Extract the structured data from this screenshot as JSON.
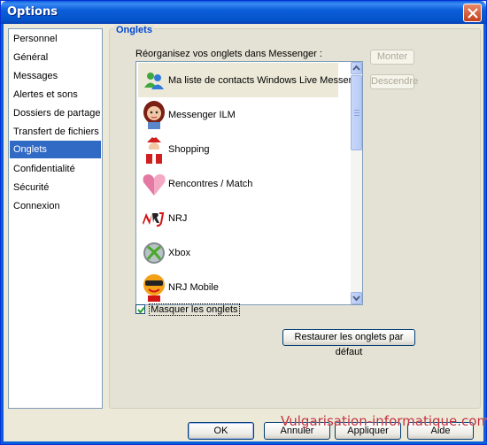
{
  "window": {
    "title": "Options"
  },
  "categories": [
    {
      "label": "Personnel",
      "selected": false
    },
    {
      "label": "Général",
      "selected": false
    },
    {
      "label": "Messages",
      "selected": false
    },
    {
      "label": "Alertes et sons",
      "selected": false
    },
    {
      "label": "Dossiers de partage",
      "selected": false
    },
    {
      "label": "Transfert de fichiers",
      "selected": false
    },
    {
      "label": "Onglets",
      "selected": true
    },
    {
      "label": "Confidentialité",
      "selected": false
    },
    {
      "label": "Sécurité",
      "selected": false
    },
    {
      "label": "Connexion",
      "selected": false
    }
  ],
  "panel": {
    "title": "Onglets",
    "instruction": "Réorganisez vos onglets dans Messenger :",
    "tabs": [
      {
        "label": "Ma liste de contacts Windows Live Messenger",
        "icon": "contacts-icon",
        "selected": true
      },
      {
        "label": "Messenger ILM",
        "icon": "girl-avatar-icon",
        "selected": false
      },
      {
        "label": "Shopping",
        "icon": "santa-shopping-icon",
        "selected": false
      },
      {
        "label": "Rencontres / Match",
        "icon": "heart-icon",
        "selected": false
      },
      {
        "label": "NRJ",
        "icon": "nrj-logo-icon",
        "selected": false
      },
      {
        "label": "Xbox",
        "icon": "xbox-icon",
        "selected": false
      },
      {
        "label": "NRJ Mobile",
        "icon": "nrj-mobile-icon",
        "selected": false
      }
    ],
    "move_up": "Monter",
    "move_down": "Descendre",
    "hide_tabs": {
      "label": "Masquer les onglets",
      "checked": true
    },
    "restore": "Restaurer les onglets par défaut"
  },
  "footer": {
    "ok": "OK",
    "cancel": "Annuler",
    "apply": "Appliquer",
    "help": "Aide"
  },
  "watermark": "Vulgarisation-informatique.com",
  "colors": {
    "selection": "#316ac5",
    "title_bar": "#0a5fd8",
    "group_title": "#0046d5",
    "watermark": "#c0303a"
  }
}
